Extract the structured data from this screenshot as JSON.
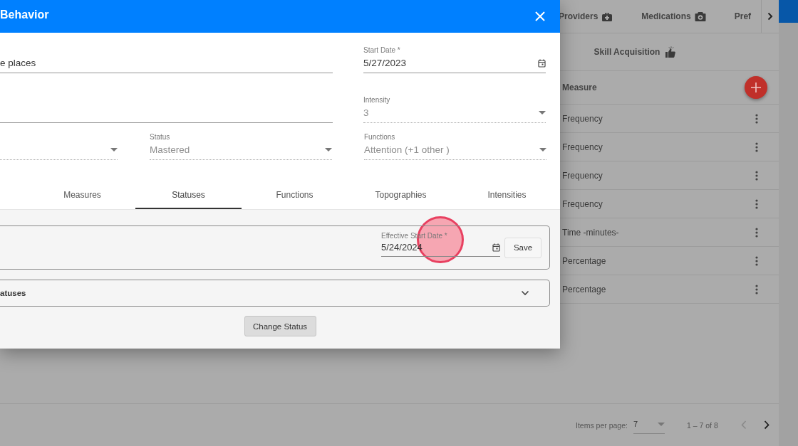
{
  "dialog": {
    "title": "Behavior",
    "name_field": {
      "value": "e places"
    },
    "start_date": {
      "label": "Start Date *",
      "value": "5/27/2023"
    },
    "intensity": {
      "label": "Intensity",
      "value": "3",
      "disabled": true
    },
    "selects": [
      {
        "disabled": true
      },
      {
        "label": "Status",
        "value": "Mastered",
        "disabled": true
      },
      {
        "label": "Functions",
        "value": "Attention (+1 other )",
        "disabled": true
      }
    ],
    "tabs": [
      {
        "label": "Measures",
        "selected": false
      },
      {
        "label": "Statuses",
        "selected": true
      },
      {
        "label": "Functions",
        "selected": false
      },
      {
        "label": "Topographies",
        "selected": false
      },
      {
        "label": "Intensities",
        "selected": false
      }
    ],
    "status_card": {
      "date_label": "Effective Start Date *",
      "date_value": "5/24/2024",
      "save_label": "Save"
    },
    "history_panel": {
      "title": "atuses",
      "expanded": false
    },
    "change_button": "Change Status"
  },
  "background": {
    "tabs": [
      {
        "label": "Providers"
      },
      {
        "label": "Medications"
      },
      {
        "label": "Pref"
      }
    ],
    "subtab": {
      "label": "Skill Acquisition"
    },
    "table": {
      "columns": [
        "Measure"
      ],
      "rows": [
        {
          "measure": "Frequency"
        },
        {
          "measure": "Frequency"
        },
        {
          "measure": "Frequency"
        },
        {
          "measure": "Frequency"
        },
        {
          "measure": "Time -minutes-"
        },
        {
          "measure": "Percentage"
        },
        {
          "measure": "Percentage"
        }
      ]
    },
    "paginator": {
      "label": "Items per page:",
      "page_size": "7",
      "range": "1 – 7 of 8"
    }
  }
}
